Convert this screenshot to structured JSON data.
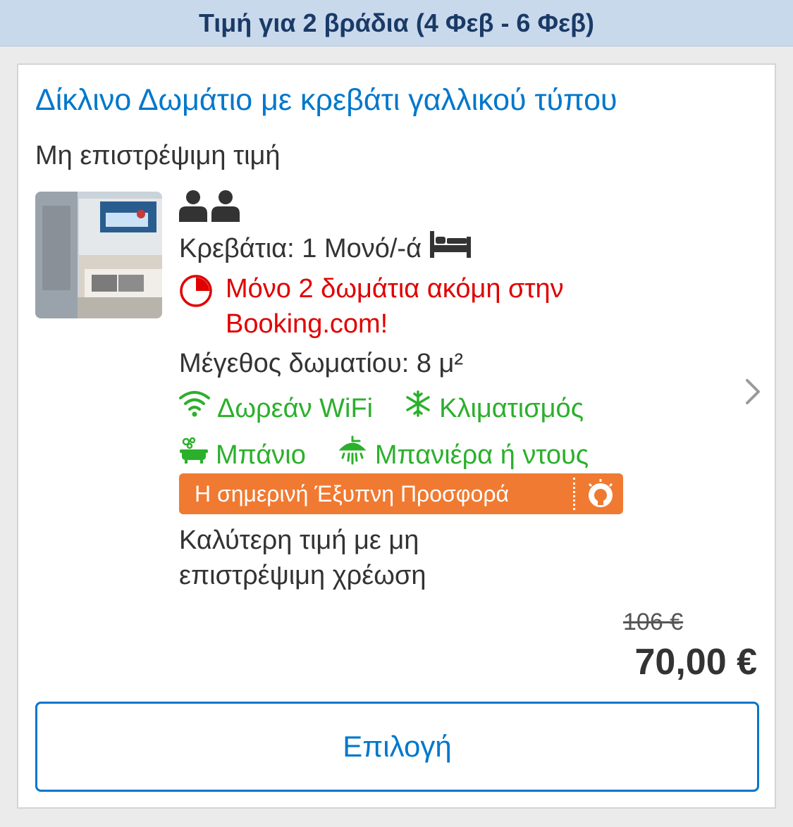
{
  "banner": {
    "text": "Τιμή για 2 βράδια (4 Φεβ - 6 Φεβ)"
  },
  "room": {
    "title": "Δίκλινο Δωμάτιο με κρεβάτι γαλλικού τύπου",
    "policy": "Μη επιστρέψιμη τιμή",
    "occupancy_icons": [
      "person-icon",
      "person-icon"
    ],
    "beds": "Κρεβάτια: 1 Μονό/-ά",
    "beds_icon": "bed-icon",
    "scarcity": "Μόνο 2 δωμάτια ακόμη στην Booking.com!",
    "size": "Μέγεθος δωματίου: 8 μ²",
    "facilities": [
      {
        "label": "Δωρεάν WiFi",
        "icon": "wifi-icon"
      },
      {
        "label": "Κλιματισμός",
        "icon": "snowflake-icon"
      },
      {
        "label": "Μπάνιο",
        "icon": "bathtub-icon"
      },
      {
        "label": "Μπανιέρα ή ντους",
        "icon": "shower-icon"
      }
    ]
  },
  "deal": {
    "label": "Η σημερινή Έξυπνη Προσφορά",
    "icon": "lightbulb-icon",
    "description": "Καλύτερη τιμή με μη επιστρέψιμη χρέωση"
  },
  "pricing": {
    "old_price": "106 €",
    "price": "70,00 €"
  },
  "action": {
    "select_label": "Επιλογή"
  },
  "colors": {
    "brand_blue": "#0077cc",
    "scarcity_red": "#e00000",
    "facility_green": "#2bb02b",
    "deal_orange": "#f07a31",
    "banner_bg": "#c9d9ec"
  }
}
